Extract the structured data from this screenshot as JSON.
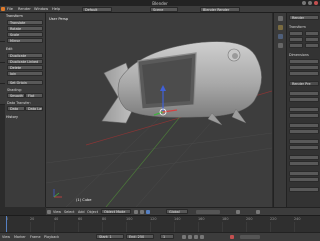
{
  "window": {
    "title": "Blender"
  },
  "menubar": {
    "items": [
      "File",
      "Render",
      "Window",
      "Help"
    ],
    "layout": "Default",
    "scene": "Scene",
    "engine": "Blender Render"
  },
  "toolshelf": {
    "transform_header": "Transform",
    "transform_buttons": [
      "Translate",
      "Rotate",
      "Scale",
      "Mirror"
    ],
    "edit_header": "Edit",
    "edit_buttons": [
      "Duplicate",
      "Duplicate Linked",
      "Delete",
      "Join"
    ],
    "set_origin": "Set Origin",
    "shading_label": "Shading:",
    "shading_buttons": [
      "Smooth",
      "Flat"
    ],
    "data_transfer_label": "Data Transfer:",
    "data_buttons": [
      "Data",
      "Data Layout"
    ],
    "history_header": "History"
  },
  "viewport": {
    "view_label": "User Persp",
    "object_label": "(1) Cube"
  },
  "properties": {
    "render_label": "Render",
    "tabs": [
      "Transform",
      "Dimensions",
      "Render Pre"
    ]
  },
  "view_header": {
    "menus": [
      "View",
      "Select",
      "Add",
      "Object"
    ],
    "mode": "Object Mode",
    "pivot": "Global"
  },
  "timeline": {
    "ticks": [
      "0",
      "20",
      "40",
      "60",
      "80",
      "100",
      "120",
      "140",
      "160",
      "180",
      "200",
      "220",
      "240"
    ],
    "footer_menus": [
      "View",
      "Marker",
      "Frame",
      "Playback"
    ],
    "start": "Start: 1",
    "end": "End: 250",
    "current": "1"
  },
  "colors": {
    "accent": "#5680c2",
    "selection_origin": "#ffffff",
    "axis_x": "#d44040",
    "axis_y": "#40b040",
    "axis_z": "#4060d8"
  }
}
